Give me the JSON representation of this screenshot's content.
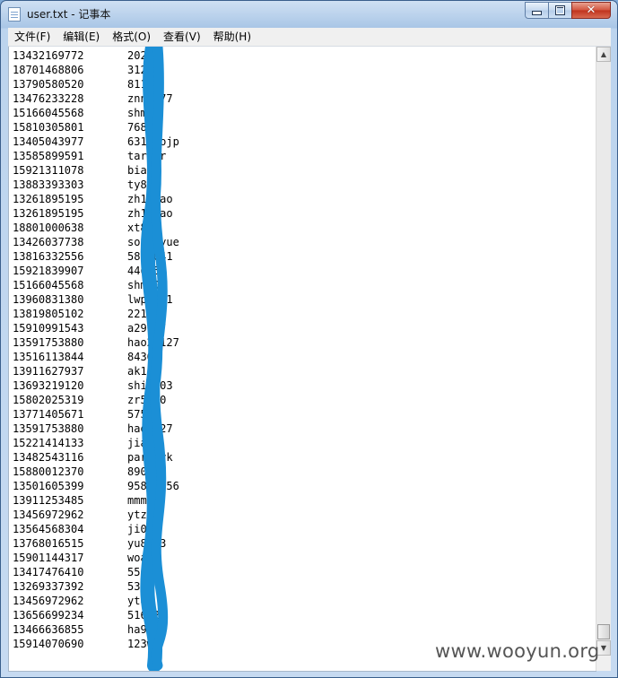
{
  "window": {
    "title": "user.txt - 记事本"
  },
  "menu": [
    "文件(F)",
    "编辑(E)",
    "格式(O)",
    "查看(V)",
    "帮助(H)"
  ],
  "lines": [
    [
      "13432169772",
      "2023a"
    ],
    [
      "18701468806",
      "3124"
    ],
    [
      "13790580520",
      "8118"
    ],
    [
      "13476233228",
      "znn2077"
    ],
    [
      "15166045568",
      "shm20"
    ],
    [
      "15810305801",
      "76823"
    ],
    [
      "13405043977",
      "63139ojp"
    ],
    [
      "13585899591",
      "tardar"
    ],
    [
      "15921311078",
      "bia12"
    ],
    [
      "13883393303",
      "ty815"
    ],
    [
      "13261895195",
      "zh18hao"
    ],
    [
      "13261895195",
      "zh18hao"
    ],
    [
      "18801000638",
      "xt886"
    ],
    [
      "13426037738",
      "soniayue"
    ],
    [
      "13816332556",
      "5886041"
    ],
    [
      "15921839907",
      "446752"
    ],
    [
      "15166045568",
      "shm20"
    ],
    [
      "13960831380",
      "lwp9871"
    ],
    [
      "13819805102",
      "22191"
    ],
    [
      "15910991543",
      "a29677"
    ],
    [
      "13591753880",
      "hao28127"
    ],
    [
      "13516113844",
      "84368"
    ],
    [
      "13911627937",
      "ak125"
    ],
    [
      "13693219120",
      "shi0503"
    ],
    [
      "15802025319",
      "zr5280"
    ],
    [
      "13771405671",
      "57520"
    ],
    [
      "13591753880",
      "hao8127"
    ],
    [
      "15221414133",
      "jiaxi"
    ],
    [
      "13482543116",
      "parkark"
    ],
    [
      "15880012370",
      "89020"
    ],
    [
      "13501605399",
      "95820056"
    ],
    [
      "13911253485",
      "mmm1"
    ],
    [
      "13456972962",
      "ytz38"
    ],
    [
      "13564568304",
      "ji08"
    ],
    [
      "13768016515",
      "yu8423"
    ],
    [
      "15901144317",
      "woay"
    ],
    [
      "13417476410",
      "55626"
    ],
    [
      "13269337392",
      "537"
    ],
    [
      "13456972962",
      "yt88"
    ],
    [
      "13656699234",
      "51682"
    ],
    [
      "13466636855",
      "ha902"
    ],
    [
      "15914070690",
      "123we"
    ]
  ],
  "watermark": "www.wooyun.org",
  "colors": {
    "redaction": "#1b8fd6",
    "titlebar": "#bcd4ee"
  },
  "icons": {
    "app": "notepad-icon",
    "minimize": "minimize-icon",
    "maximize": "maximize-icon",
    "close": "close-icon"
  }
}
